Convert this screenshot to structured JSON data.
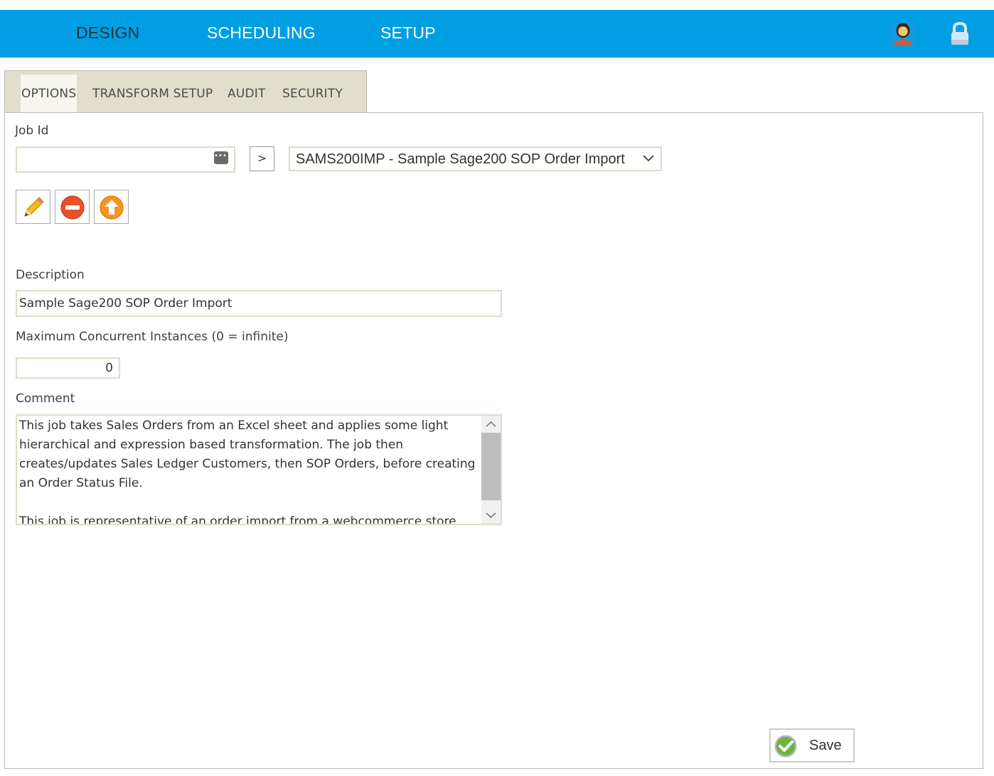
{
  "nav": {
    "items": [
      "DESIGN",
      "SCHEDULING",
      "SETUP"
    ],
    "active": "DESIGN",
    "icons": [
      "user-icon",
      "lock-icon"
    ]
  },
  "tabs": [
    "OPTIONS",
    "TRANSFORM SETUP",
    "AUDIT",
    "SECURITY"
  ],
  "active_tab": "OPTIONS",
  "form": {
    "job_id": {
      "label": "Job Id",
      "value": "",
      "go_label": ">",
      "selected_job": "SAMS200IMP - Sample Sage200 SOP Order Import"
    },
    "description": {
      "label": "Description",
      "value": "Sample Sage200 SOP Order Import"
    },
    "max_instances": {
      "label": "Maximum Concurrent Instances (0 = infinite)",
      "value": "0"
    },
    "comment": {
      "label": "Comment",
      "value": "This job takes Sales Orders from an Excel sheet and applies some light hierarchical and expression based transformation. The job then creates/updates Sales Ledger Customers, then SOP Orders, before creating an Order Status File.\n\nThis job is representative of an order import from a webcommerce store"
    }
  },
  "actions": {
    "save_label": "Save",
    "toolbar_icons": [
      "pencil-icon",
      "minus-circle-icon",
      "up-arrow-circle-icon"
    ]
  },
  "colors": {
    "topbar": "#009fe3",
    "active_nav": "#233446",
    "tab_strip": "#e1dfcb",
    "field_border": "#dcdccc"
  }
}
